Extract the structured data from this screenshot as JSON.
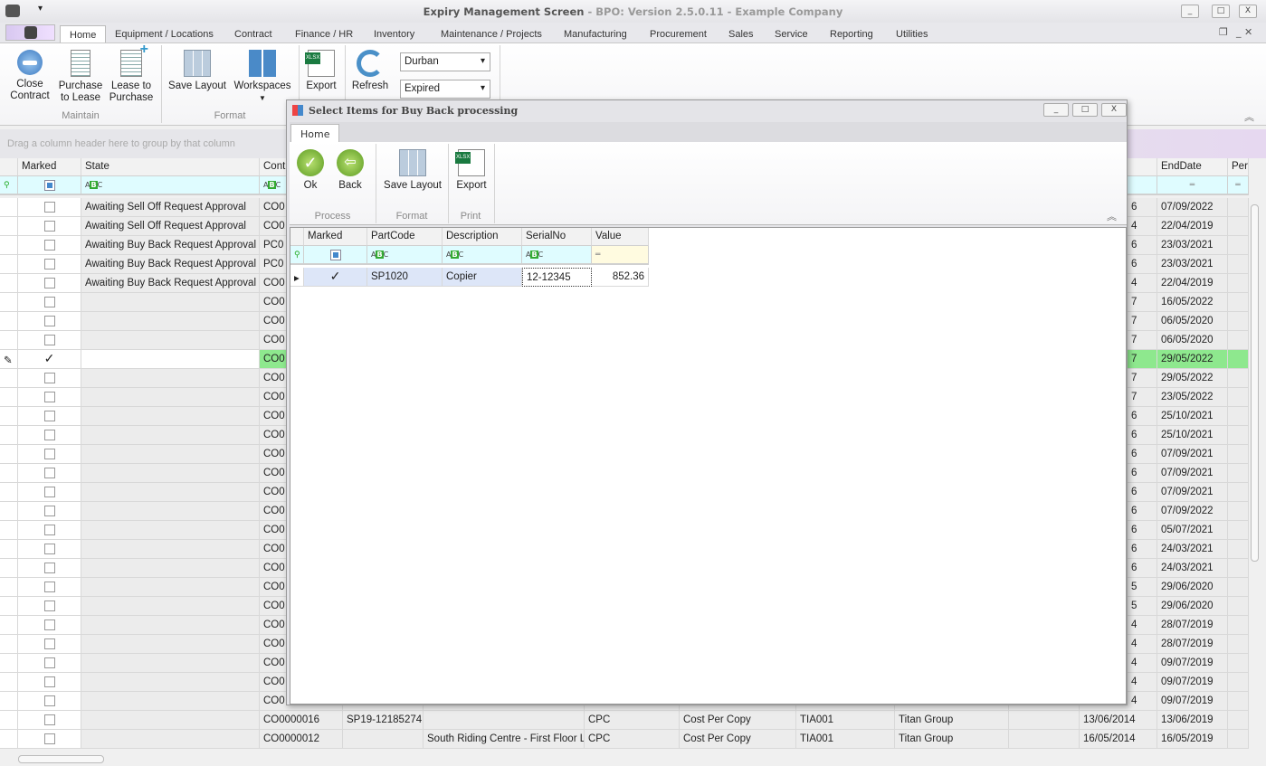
{
  "window": {
    "title": "Expiry Management Screen",
    "subtitle": " - BPO: Version 2.5.0.11 - Example Company",
    "min": "_",
    "max": "□",
    "close": "X"
  },
  "tabs": [
    "Home",
    "Equipment / Locations",
    "Contract",
    "Finance / HR",
    "Inventory",
    "Maintenance / Projects",
    "Manufacturing",
    "Procurement",
    "Sales",
    "Service",
    "Reporting",
    "Utilities"
  ],
  "ribbon": {
    "close_contract": "Close\nContract",
    "purchase_to_lease": "Purchase\nto Lease",
    "lease_to_purchase": "Lease to\nPurchase",
    "save_layout": "Save Layout",
    "workspaces": "Workspaces",
    "export": "Export",
    "refresh": "Refresh",
    "branch": "Durban",
    "status": "Expired",
    "group_maintain": "Maintain",
    "group_format": "Format"
  },
  "groupby_hint": "Drag a column header here to group by that column",
  "grid": {
    "headers": {
      "marked": "Marked",
      "state": "State",
      "contract": "Cont",
      "enddate": "EndDate",
      "period": "Period"
    },
    "rows": [
      {
        "marked": false,
        "state": "Awaiting Sell Off Request Approval",
        "contract": "CO0",
        "start": "6",
        "end": "07/09/2022"
      },
      {
        "marked": false,
        "state": "Awaiting Sell Off Request Approval",
        "contract": "CO0",
        "start": "4",
        "end": "22/04/2019"
      },
      {
        "marked": false,
        "state": "Awaiting Buy Back Request Approval",
        "contract": "PC0",
        "start": "6",
        "end": "23/03/2021"
      },
      {
        "marked": false,
        "state": "Awaiting Buy Back Request Approval",
        "contract": "PC0",
        "start": "6",
        "end": "23/03/2021"
      },
      {
        "marked": false,
        "state": "Awaiting Buy Back Request Approval",
        "contract": "CO0",
        "start": "4",
        "end": "22/04/2019"
      },
      {
        "marked": false,
        "state": "",
        "contract": "CO0",
        "start": "7",
        "end": "16/05/2022"
      },
      {
        "marked": false,
        "state": "",
        "contract": "CO0",
        "start": "7",
        "end": "06/05/2020"
      },
      {
        "marked": false,
        "state": "",
        "contract": "CO0",
        "start": "7",
        "end": "06/05/2020"
      },
      {
        "marked": true,
        "selected": true,
        "state": "",
        "contract": "CO0",
        "start": "7",
        "end": "29/05/2022"
      },
      {
        "marked": false,
        "state": "",
        "contract": "CO0",
        "start": "7",
        "end": "29/05/2022"
      },
      {
        "marked": false,
        "state": "",
        "contract": "CO0",
        "start": "7",
        "end": "23/05/2022"
      },
      {
        "marked": false,
        "state": "",
        "contract": "CO0",
        "start": "6",
        "end": "25/10/2021"
      },
      {
        "marked": false,
        "state": "",
        "contract": "CO0",
        "start": "6",
        "end": "25/10/2021"
      },
      {
        "marked": false,
        "state": "",
        "contract": "CO0",
        "start": "6",
        "end": "07/09/2021"
      },
      {
        "marked": false,
        "state": "",
        "contract": "CO0",
        "start": "6",
        "end": "07/09/2021"
      },
      {
        "marked": false,
        "state": "",
        "contract": "CO0",
        "start": "6",
        "end": "07/09/2021"
      },
      {
        "marked": false,
        "state": "",
        "contract": "CO0",
        "start": "6",
        "end": "07/09/2022"
      },
      {
        "marked": false,
        "state": "",
        "contract": "CO0",
        "start": "6",
        "end": "05/07/2021"
      },
      {
        "marked": false,
        "state": "",
        "contract": "CO0",
        "start": "6",
        "end": "24/03/2021"
      },
      {
        "marked": false,
        "state": "",
        "contract": "CO0",
        "start": "6",
        "end": "24/03/2021"
      },
      {
        "marked": false,
        "state": "",
        "contract": "CO0",
        "start": "5",
        "end": "29/06/2020"
      },
      {
        "marked": false,
        "state": "",
        "contract": "CO0",
        "start": "5",
        "end": "29/06/2020"
      },
      {
        "marked": false,
        "state": "",
        "contract": "CO0",
        "start": "4",
        "end": "28/07/2019"
      },
      {
        "marked": false,
        "state": "",
        "contract": "CO0",
        "start": "4",
        "end": "28/07/2019"
      },
      {
        "marked": false,
        "state": "",
        "contract": "CO0",
        "start": "4",
        "end": "09/07/2019"
      },
      {
        "marked": false,
        "state": "",
        "contract": "CO0",
        "start": "4",
        "end": "09/07/2019"
      },
      {
        "marked": false,
        "state": "",
        "contract": "CO0",
        "start": "4",
        "end": "09/07/2019"
      },
      {
        "marked": false,
        "state": "",
        "contract": "CO0000016",
        "serial": "SP19-12185274",
        "site": "",
        "type": "CPC",
        "type_desc": "Cost Per Copy",
        "cust": "TIA001",
        "cust_name": "Titan Group",
        "start": "13/06/2014",
        "end": "13/06/2019"
      },
      {
        "marked": false,
        "state": "",
        "contract": "CO0000012",
        "serial": "",
        "site": "South Riding Centre - First Floor LB",
        "type": "CPC",
        "type_desc": "Cost Per Copy",
        "cust": "TIA001",
        "cust_name": "Titan Group",
        "start": "16/05/2014",
        "end": "16/05/2019"
      }
    ]
  },
  "dialog": {
    "title": "Select Items for Buy Back processing",
    "tab": "Home",
    "ok": "Ok",
    "back": "Back",
    "save_layout": "Save Layout",
    "export": "Export",
    "group_process": "Process",
    "group_format": "Format",
    "group_print": "Print",
    "headers": [
      "Marked",
      "PartCode",
      "Description",
      "SerialNo",
      "Value"
    ],
    "rows": [
      {
        "marked": true,
        "partcode": "SP1020",
        "description": "Copier",
        "serialno": "12-12345",
        "value": "852.36"
      }
    ]
  },
  "colors": {
    "selected_row": "#8ee88e",
    "filter_row": "#dffcff",
    "accent_green": "#3a3"
  }
}
